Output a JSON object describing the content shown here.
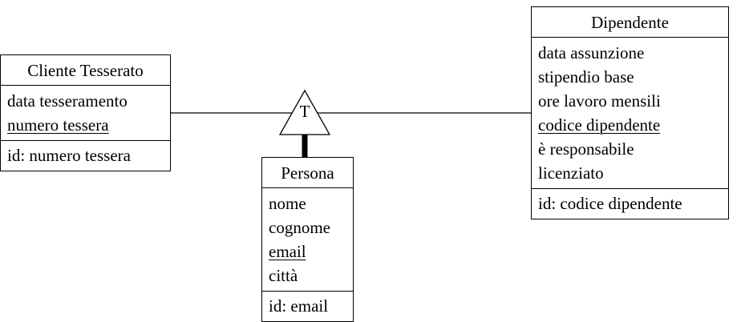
{
  "entities": {
    "cliente": {
      "name": "Cliente Tesserato",
      "attributes": [
        {
          "label": "data tesseramento",
          "key": false
        },
        {
          "label": "numero tessera",
          "key": true
        }
      ],
      "identifier": "id: numero tessera"
    },
    "persona": {
      "name": "Persona",
      "attributes": [
        {
          "label": "nome",
          "key": false
        },
        {
          "label": "cognome",
          "key": false
        },
        {
          "label": "email",
          "key": true
        },
        {
          "label": "città",
          "key": false
        }
      ],
      "identifier": "id: email"
    },
    "dipendente": {
      "name": "Dipendente",
      "attributes": [
        {
          "label": "data assunzione",
          "key": false
        },
        {
          "label": "stipendio base",
          "key": false
        },
        {
          "label": "ore lavoro mensili",
          "key": false
        },
        {
          "label": "codice dipendente",
          "key": true
        },
        {
          "label": "è responsabile",
          "key": false
        },
        {
          "label": "licenziato",
          "key": false
        }
      ],
      "identifier": "id: codice dipendente"
    }
  },
  "generalization": {
    "coverage_label": "T"
  }
}
